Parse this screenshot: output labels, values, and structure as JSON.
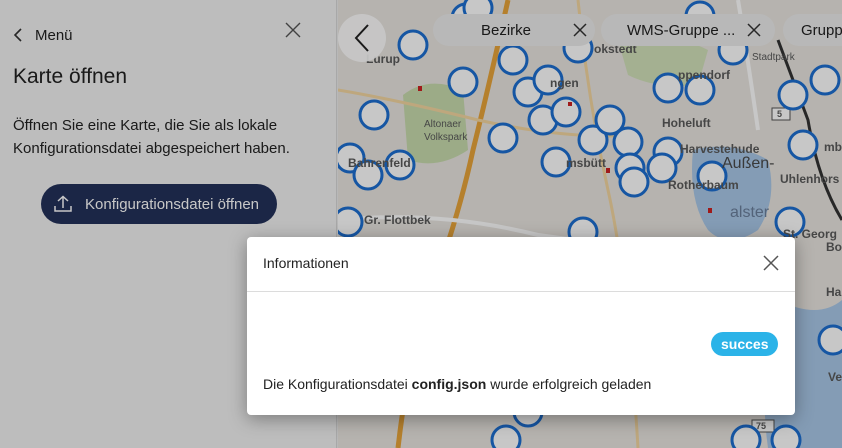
{
  "panel": {
    "menu_label": "Menü",
    "title": "Karte öffnen",
    "description": "Öffnen Sie eine Karte, die Sie als lokale Konfigurationsdatei abgespeichert haben.",
    "open_button_label": "Konfigurationsdatei öffnen"
  },
  "map": {
    "chips": [
      {
        "label": "Bezirke"
      },
      {
        "label": "WMS-Gruppe ..."
      },
      {
        "label": "Grupp"
      }
    ],
    "labels": {
      "lurup": "Lurup",
      "altonaer_volkspark": "Altonaer\nVolkspark",
      "bahrenfeld": "Bahrenfeld",
      "gr_flottbek": "Gr. Flottbek",
      "hoheluft": "Hoheluft",
      "harvestehude": "Harvestehude",
      "rotherbaum": "Rotherbaum",
      "aussen": "Außen-",
      "alster": "alster",
      "uhlenhorst": "Uhlenhors",
      "st_georg": "St. Georg",
      "stadtpark": "Stadtpark",
      "bahrenbek": "mbe",
      "bo": "Bo",
      "ham": "Ham",
      "ve": "Ve",
      "eppendorf": "ppendorf",
      "ngen": "ngen",
      "okstedt": "okstedt",
      "msbuttel": "msbütt",
      "road_5": "5",
      "road_75": "75"
    },
    "colors": {
      "road": "#e8a53a",
      "water": "#a9c8e8",
      "park": "#c8dcae",
      "marker": "#1d6fd1"
    }
  },
  "modal": {
    "title": "Informationen",
    "badge": "succes",
    "message_prefix": "Die Konfigurationsdatei ",
    "message_file": "config.json",
    "message_suffix": " wurde erfolgreich geladen"
  }
}
